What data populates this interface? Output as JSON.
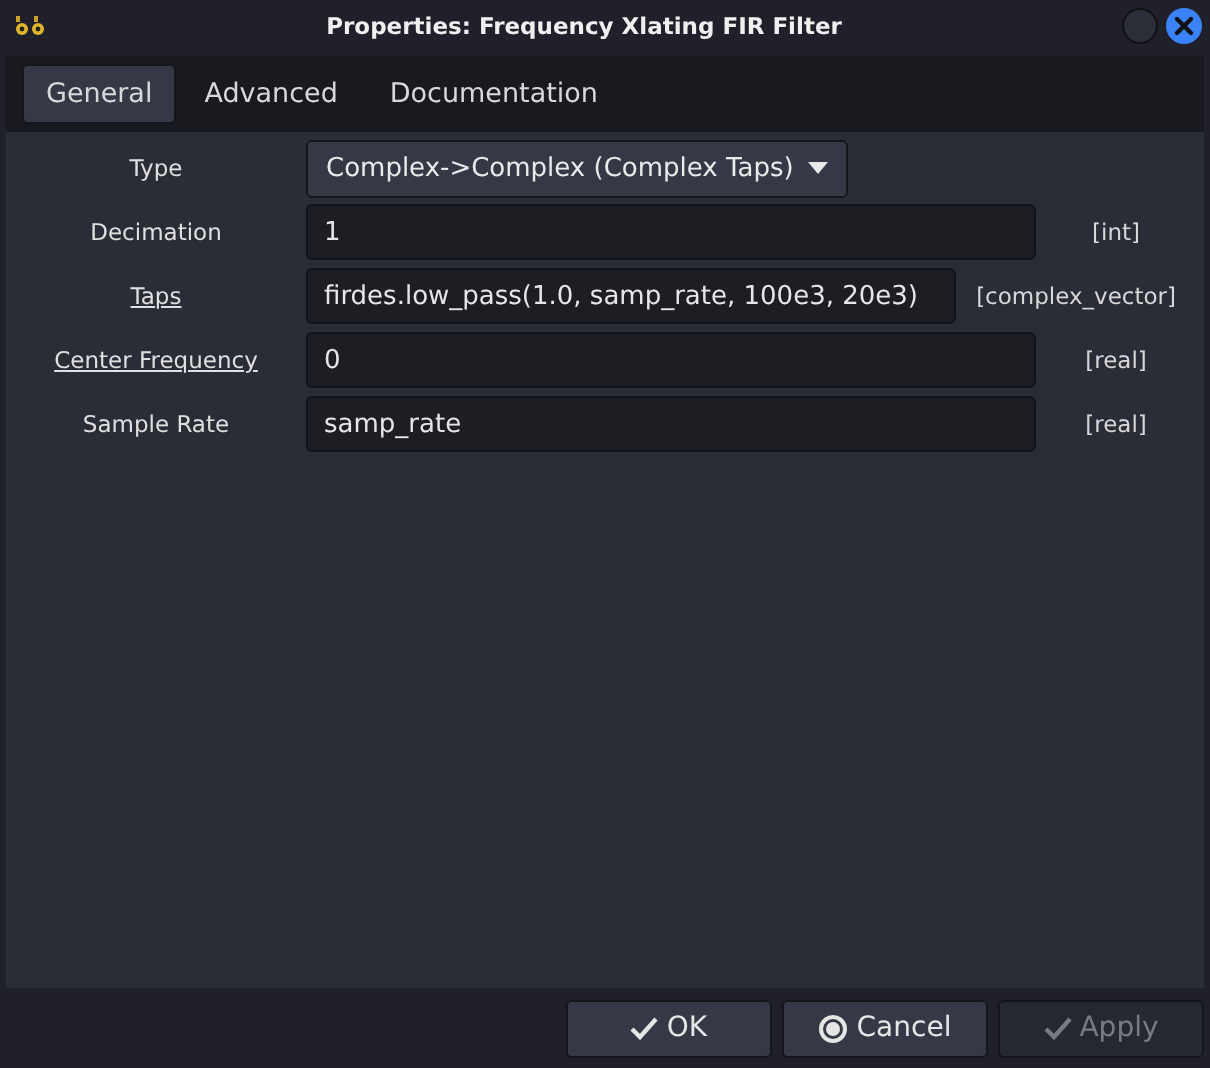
{
  "window": {
    "title": "Properties: Frequency Xlating FIR Filter"
  },
  "tabs": [
    {
      "label": "General",
      "selected": true
    },
    {
      "label": "Advanced",
      "selected": false
    },
    {
      "label": "Documentation",
      "selected": false
    }
  ],
  "params": [
    {
      "kind": "dropdown",
      "label": "Type",
      "underlined": false,
      "value": "Complex->Complex (Complex Taps)"
    },
    {
      "kind": "entry",
      "label": "Decimation",
      "underlined": false,
      "value": "1",
      "type": "[int]"
    },
    {
      "kind": "entry",
      "label": "Taps",
      "underlined": true,
      "value": "firdes.low_pass(1.0, samp_rate, 100e3, 20e3)",
      "type": "[complex_vector]"
    },
    {
      "kind": "entry",
      "label": "Center Frequency",
      "underlined": true,
      "value": "0",
      "type": "[real]"
    },
    {
      "kind": "entry",
      "label": "Sample Rate",
      "underlined": false,
      "value": "samp_rate",
      "type": "[real]"
    }
  ],
  "buttons": [
    {
      "kind": "ok",
      "label": "OK",
      "disabled": false
    },
    {
      "kind": "cancel",
      "label": "Cancel",
      "disabled": false
    },
    {
      "kind": "apply",
      "label": "Apply",
      "disabled": true
    }
  ]
}
